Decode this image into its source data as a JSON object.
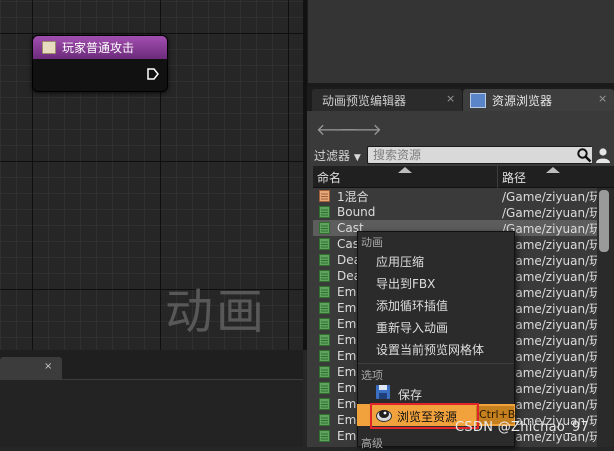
{
  "graph": {
    "node_title": "玩家普通攻击",
    "watermark": "动画"
  },
  "tabs": [
    {
      "label": "动画预览编辑器",
      "close": "×"
    },
    {
      "label": "资源浏览器",
      "close": "×"
    }
  ],
  "toolbar": {
    "back_arrow": "🡐",
    "forward_arrow": "🡒",
    "filter_label": "过滤器",
    "search_placeholder": "搜索资源"
  },
  "columns": {
    "name": "命名",
    "path": "路径"
  },
  "rows": [
    {
      "name": "1混合",
      "path": "/Game/ziyuan/玩",
      "icon": "blendspace-icon",
      "selected": false
    },
    {
      "name": "Bound",
      "path": "/Game/ziyuan/玩",
      "icon": "anim-sequence-icon",
      "selected": false
    },
    {
      "name": "Cast",
      "path": "/Game/ziyuan/玩",
      "icon": "anim-sequence-icon",
      "selected": true
    },
    {
      "name": "Cas",
      "path": "/Game/ziyuan/玩",
      "icon": "anim-sequence-icon",
      "selected": false
    },
    {
      "name": "Dea",
      "path": "/Game/ziyuan/玩",
      "icon": "anim-sequence-icon",
      "selected": false
    },
    {
      "name": "Dea",
      "path": "/Game/ziyuan/玩",
      "icon": "anim-sequence-icon",
      "selected": false
    },
    {
      "name": "Eme",
      "path": "/Game/ziyuan/玩",
      "icon": "anim-sequence-icon",
      "selected": false
    },
    {
      "name": "Eme",
      "path": "/Game/ziyuan/玩",
      "icon": "anim-sequence-icon",
      "selected": false
    },
    {
      "name": "Eme",
      "path": "/Game/ziyuan/玩",
      "icon": "anim-sequence-icon",
      "selected": false
    },
    {
      "name": "Eme",
      "path": "/Game/ziyuan/玩",
      "icon": "anim-sequence-icon",
      "selected": false
    },
    {
      "name": "Eme",
      "path": "/Game/ziyuan/玩",
      "icon": "anim-sequence-icon",
      "selected": false
    },
    {
      "name": "Eme",
      "path": "/Game/ziyuan/玩",
      "icon": "anim-sequence-icon",
      "selected": false
    },
    {
      "name": "Eme",
      "path": "/Game/ziyuan/玩",
      "icon": "anim-sequence-icon",
      "selected": false
    },
    {
      "name": "Eme",
      "path": "/Game/ziyuan/玩",
      "icon": "anim-sequence-icon",
      "selected": false
    },
    {
      "name": "Eme",
      "path": "/Game/ziyuan/玩",
      "icon": "anim-sequence-icon",
      "selected": false
    },
    {
      "name": "Eme",
      "path": "/Game/ziyuan/玩",
      "icon": "anim-sequence-icon",
      "selected": false
    }
  ],
  "context_menu": {
    "section_animation": "动画",
    "items": [
      "应用压缩",
      "导出到FBX",
      "添加循环插值",
      "重新导入动画",
      "设置当前预览网格体"
    ],
    "section_options": "选项",
    "save": "保存",
    "browse": "浏览至资源",
    "browse_shortcut": "Ctrl+B",
    "section_advanced": "高级"
  },
  "watermark_text": "CSDN @Zhichao_97",
  "colors": {
    "node_header": "#8e3f9e",
    "highlight": "#f2a23c",
    "red_outline": "#e0242a"
  }
}
